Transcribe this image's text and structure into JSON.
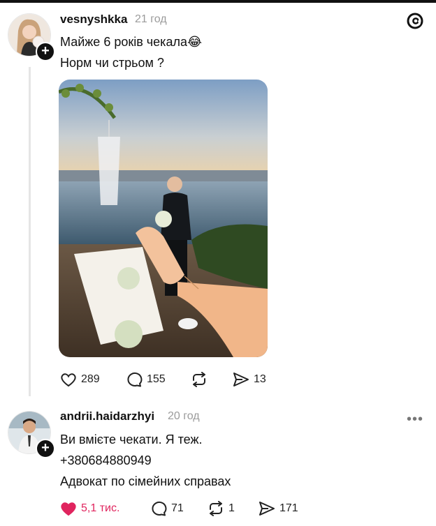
{
  "post": {
    "username": "vesnyshkka",
    "time": "21 год",
    "text_line1": "Майже 6 років чекала",
    "emoji": "😂",
    "text_line2": "Норм чи стрьом ?",
    "actions": {
      "likes": "289",
      "comments": "155",
      "reposts": "",
      "shares": "13"
    }
  },
  "reply": {
    "username": "andrii.haidarzhyi",
    "time": "20 год",
    "line1": "Ви вмієте чекати. Я теж.",
    "line2": "+380684880949",
    "line3": "Адвокат по сімейних справах",
    "actions": {
      "likes": "5,1 тис.",
      "comments": "71",
      "reposts": "1",
      "shares": "171"
    }
  },
  "icons": [
    "threads-logo-icon",
    "heart-icon",
    "comment-icon",
    "repost-icon",
    "share-icon",
    "more-icon",
    "follow-plus-icon"
  ],
  "colors": {
    "like_active": "#e0245e",
    "text": "#111111",
    "muted": "#9b9b9b"
  }
}
